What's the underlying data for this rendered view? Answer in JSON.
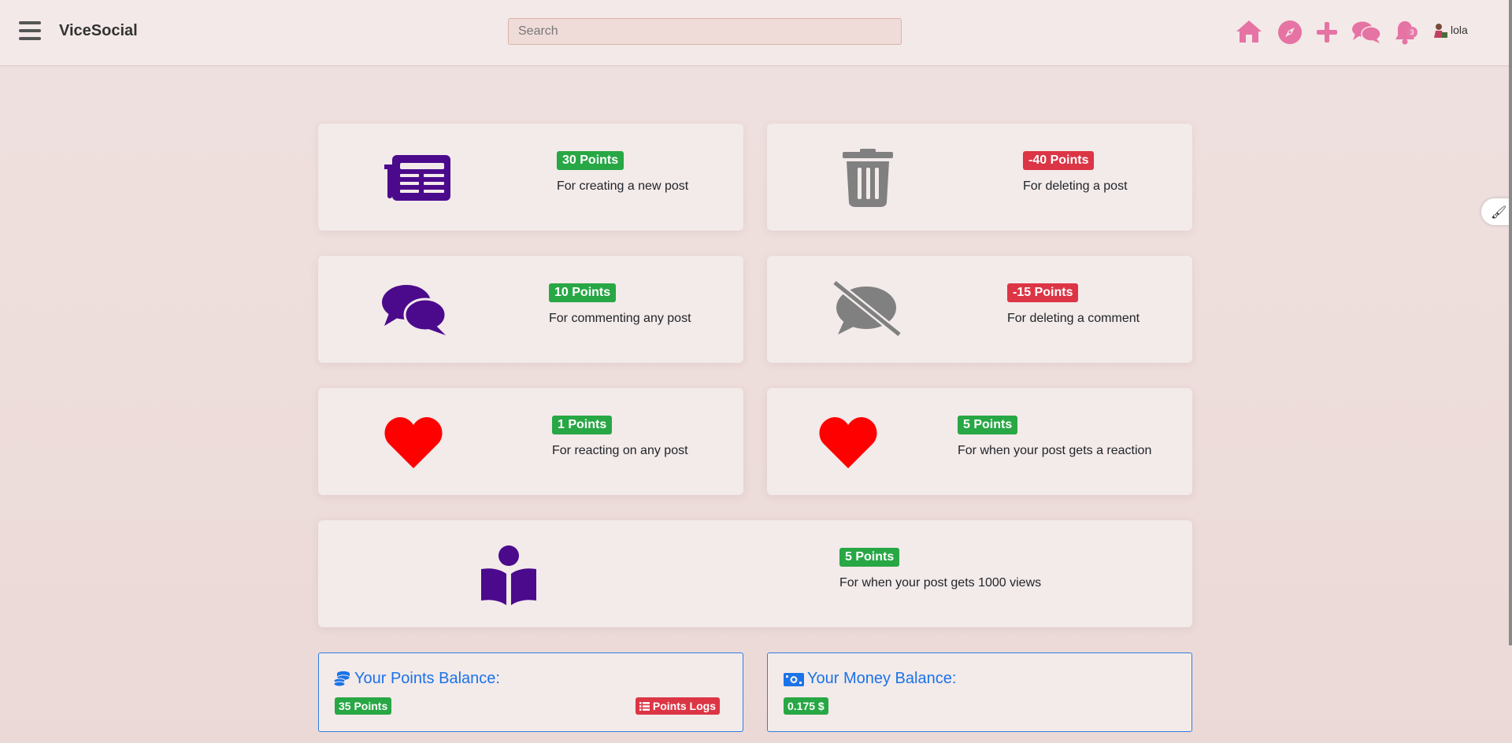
{
  "header": {
    "brand": "ViceSocial",
    "search_placeholder": "Search",
    "notification_count": "3",
    "username": "lola",
    "icons": [
      "home-icon",
      "compass-icon",
      "plus-icon",
      "comments-icon",
      "bell-icon"
    ],
    "accent_color": "#e573a4"
  },
  "cards": [
    {
      "points": "30 Points",
      "status": "positive",
      "description": "For creating a new post",
      "icon": "newspaper-icon"
    },
    {
      "points": "-40 Points",
      "status": "negative",
      "description": "For deleting a post",
      "icon": "trash-icon"
    },
    {
      "points": "10 Points",
      "status": "positive",
      "description": "For commenting any post",
      "icon": "comments-icon"
    },
    {
      "points": "-15 Points",
      "status": "negative",
      "description": "For deleting a comment",
      "icon": "comment-slash-icon"
    },
    {
      "points": "1 Points",
      "status": "positive",
      "description": "For reacting on any post",
      "icon": "heart-icon"
    },
    {
      "points": "5 Points",
      "status": "positive",
      "description": "For when your post gets a reaction",
      "icon": "heart-icon"
    },
    {
      "points": "5 Points",
      "status": "positive",
      "description": "For when your post gets 1000 views",
      "icon": "book-reader-icon"
    }
  ],
  "points_balance": {
    "title": "Your Points Balance:",
    "value": "35 Points",
    "logs_label": "Points Logs",
    "icon": "coins-icon"
  },
  "money_balance": {
    "title": "Your Money Balance:",
    "value": "0.175 $",
    "icon": "money-bill-icon"
  },
  "colors": {
    "positive": "#28a745",
    "negative": "#dc3545",
    "purple_icon": "#4b0a8c",
    "gray_icon": "#808080",
    "red_icon": "#ff0000",
    "link_blue": "#1a73e8"
  }
}
